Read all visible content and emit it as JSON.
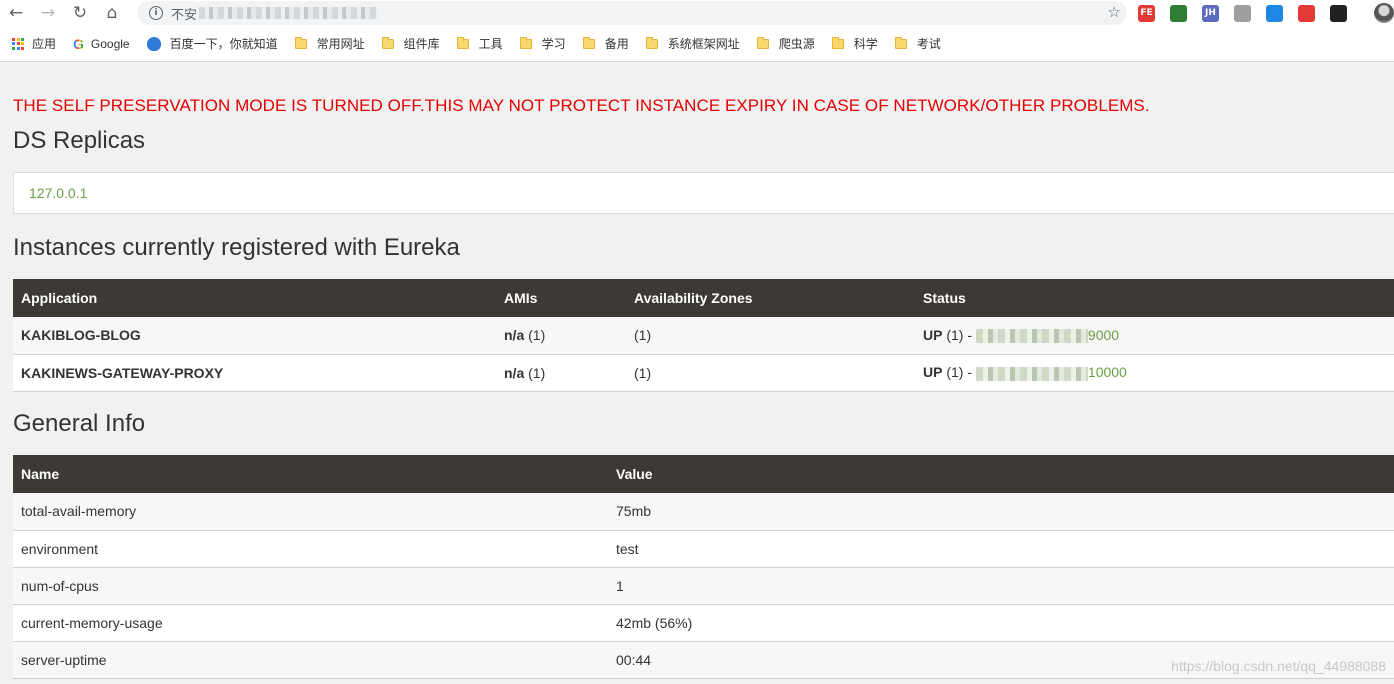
{
  "browser": {
    "address_prefix": "不安",
    "bookmarks": [
      "应用",
      "Google",
      "百度一下，你就知道",
      "常用网址",
      "组件库",
      "工具",
      "学习",
      "备用",
      "系统框架网址",
      "爬虫源",
      "科学",
      "考试"
    ],
    "extensions": [
      {
        "name": "fe-helper-icon",
        "label": "FE",
        "color": "#e53935"
      },
      {
        "name": "evernote-icon",
        "label": "",
        "color": "#2e7d32"
      },
      {
        "name": "jh-icon",
        "label": "JH",
        "color": "#5c6bc0"
      },
      {
        "name": "extension-grey-icon",
        "label": "",
        "color": "#9e9e9e"
      },
      {
        "name": "bookmark-blue-icon",
        "label": "",
        "color": "#1e88e5"
      },
      {
        "name": "cookie-icon",
        "label": "",
        "color": "#e53935"
      },
      {
        "name": "dark-extension-icon",
        "label": "",
        "color": "#212121"
      }
    ]
  },
  "warning": "THE SELF PRESERVATION MODE IS TURNED OFF.THIS MAY NOT PROTECT INSTANCE EXPIRY IN CASE OF NETWORK/OTHER PROBLEMS.",
  "ds_replicas": {
    "title": "DS Replicas",
    "replica": "127.0.0.1"
  },
  "instances": {
    "title": "Instances currently registered with Eureka",
    "headers": [
      "Application",
      "AMIs",
      "Availability Zones",
      "Status"
    ],
    "rows": [
      {
        "application": "KAKIBLOG-BLOG",
        "ami_value": "n/a",
        "ami_count": "(1)",
        "zones": "(1)",
        "status": "UP",
        "status_count": "(1) -",
        "link_suffix": "9000"
      },
      {
        "application": "KAKINEWS-GATEWAY-PROXY",
        "ami_value": "n/a",
        "ami_count": "(1)",
        "zones": "(1)",
        "status": "UP",
        "status_count": "(1) -",
        "link_suffix": "10000"
      }
    ]
  },
  "general_info": {
    "title": "General Info",
    "headers": [
      "Name",
      "Value"
    ],
    "rows": [
      {
        "name": "total-avail-memory",
        "value": "75mb"
      },
      {
        "name": "environment",
        "value": "test"
      },
      {
        "name": "num-of-cpus",
        "value": "1"
      },
      {
        "name": "current-memory-usage",
        "value": "42mb (56%)"
      },
      {
        "name": "server-uptime",
        "value": "00:44"
      }
    ]
  },
  "watermark": "https://blog.csdn.net/qq_44988088",
  "colors": {
    "warning": "#e60000",
    "link": "#6a9f41",
    "table_header": "#3d3935"
  }
}
